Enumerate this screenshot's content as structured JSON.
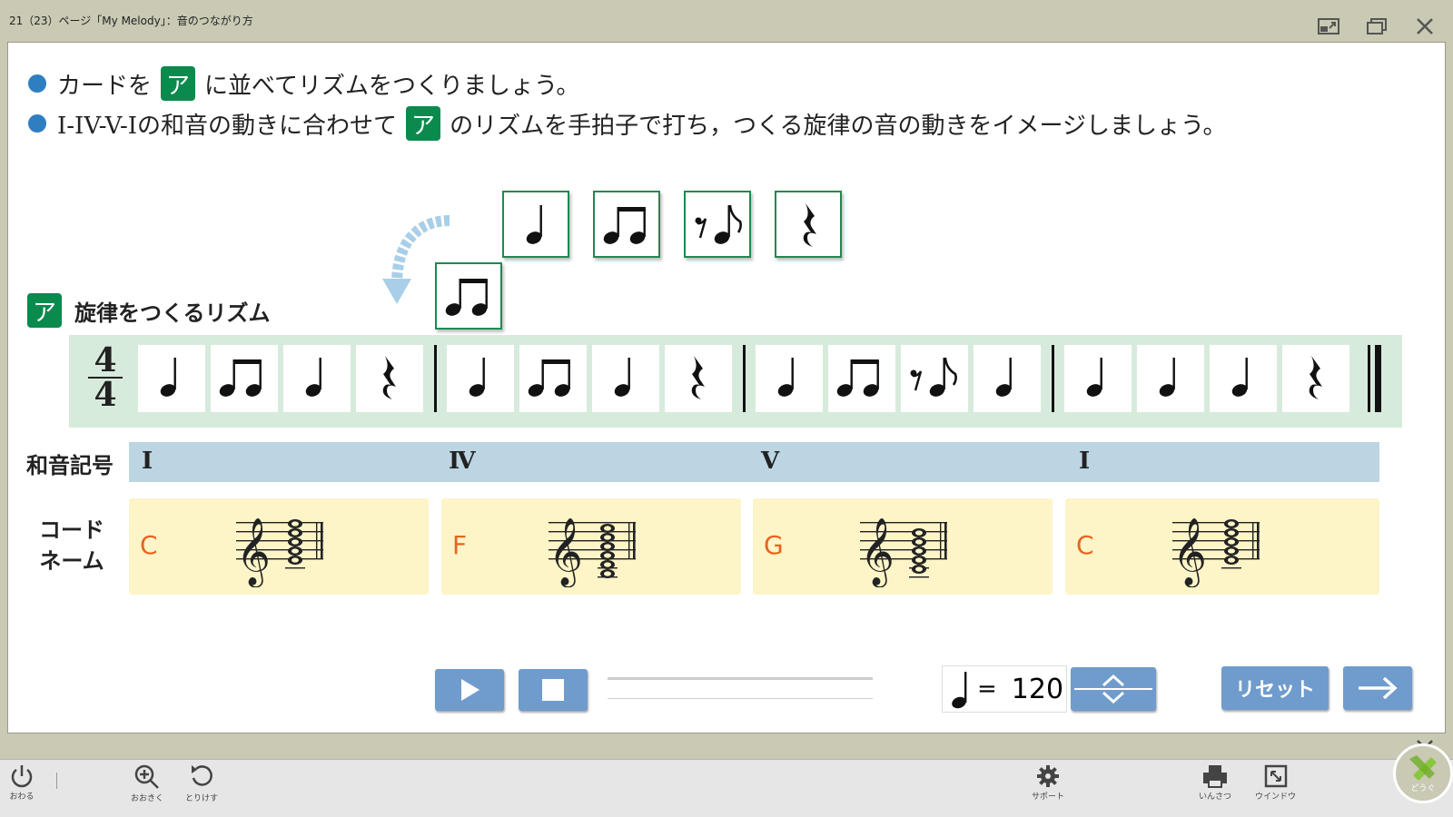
{
  "window": {
    "title": "21（23）ページ「My Melody」：音のつながり方"
  },
  "instructions": {
    "line1_a": "カードを",
    "line1_b": "に並べてリズムをつくりましょう。",
    "line2_a": "I-IV-V-Iの和音の動きに合わせて",
    "line2_b": "のリズムを手拍子で打ち，つくる旋律の音の動きをイメージしましょう。",
    "badge": "ア"
  },
  "cards": [
    "quarter-note",
    "two-eighth-notes",
    "eighth-rest-eighth-note",
    "quarter-rest"
  ],
  "dragged_card": "two-eighth-notes",
  "section": {
    "badge": "ア",
    "title": "旋律をつくるリズム"
  },
  "time_signature": {
    "top": "4",
    "bottom": "4"
  },
  "measures": [
    [
      "quarter-note",
      "two-eighth-notes",
      "quarter-note",
      "quarter-rest"
    ],
    [
      "quarter-note",
      "two-eighth-notes",
      "quarter-note",
      "quarter-rest"
    ],
    [
      "quarter-note",
      "two-eighth-notes",
      "eighth-rest-eighth-note",
      "quarter-note"
    ],
    [
      "quarter-note",
      "quarter-note",
      "quarter-note",
      "quarter-rest"
    ]
  ],
  "chord_symbols": {
    "label": "和音記号",
    "items": [
      "I",
      "Ⅳ",
      "V",
      "I"
    ]
  },
  "chord_names": {
    "label_line1": "コード",
    "label_line2": "ネーム",
    "items": [
      "C",
      "F",
      "G",
      "C"
    ]
  },
  "controls": {
    "tempo_value": "120",
    "tempo_equals": "=",
    "reset_label": "リセット"
  },
  "toolbar": {
    "quit_label": "おわる",
    "zoom_label": "おおきく",
    "undo_label": "とりけす",
    "support_label": "サポート",
    "print_label": "いんさつ",
    "window_label": "ウインドウ",
    "tools_label": "どうぐ"
  },
  "colors": {
    "badge_green": "#0a8a4d",
    "chord_orange": "#e8641e",
    "button_blue": "#6f9ccc",
    "bullet_blue": "#2f7ec2"
  }
}
